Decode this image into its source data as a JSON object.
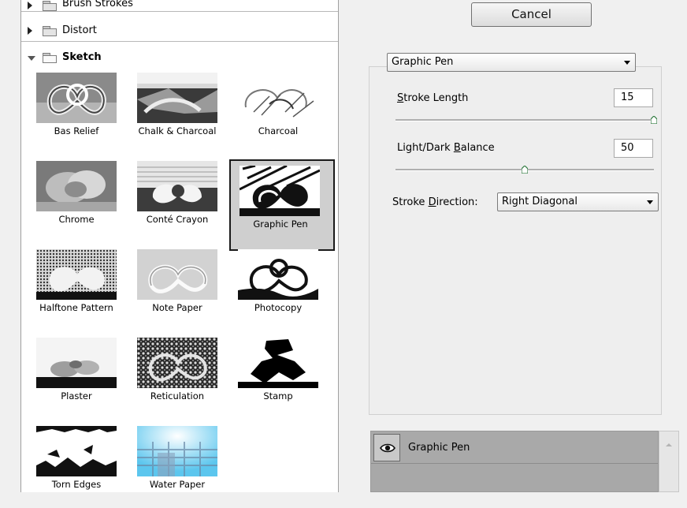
{
  "gallery": {
    "categories": [
      {
        "name": "Brush Strokes",
        "expanded": false
      },
      {
        "name": "Distort",
        "expanded": false
      },
      {
        "name": "Sketch",
        "expanded": true
      }
    ],
    "filters": [
      {
        "label": "Bas Relief"
      },
      {
        "label": "Chalk & Charcoal"
      },
      {
        "label": "Charcoal"
      },
      {
        "label": "Chrome"
      },
      {
        "label": "Conté Crayon"
      },
      {
        "label": "Graphic Pen",
        "selected": true
      },
      {
        "label": "Halftone Pattern"
      },
      {
        "label": "Note Paper"
      },
      {
        "label": "Photocopy"
      },
      {
        "label": "Plaster"
      },
      {
        "label": "Reticulation"
      },
      {
        "label": "Stamp"
      },
      {
        "label": "Torn Edges"
      },
      {
        "label": "Water Paper"
      }
    ]
  },
  "dialog": {
    "cancel_label": "Cancel"
  },
  "settings": {
    "filter_select": "Graphic Pen",
    "stroke_length": {
      "label_pre": "",
      "label_key": "S",
      "label_post": "troke Length",
      "value": "15",
      "min": 1,
      "max": 15
    },
    "light_dark": {
      "label_pre": "Light/Dark ",
      "label_key": "B",
      "label_post": "alance",
      "value": "50",
      "min": 0,
      "max": 100
    },
    "direction": {
      "label_pre": "Stroke ",
      "label_key": "D",
      "label_post": "irection:",
      "value": "Right Diagonal"
    }
  },
  "layers": {
    "items": [
      {
        "name": "Graphic Pen",
        "visible": true
      }
    ]
  }
}
